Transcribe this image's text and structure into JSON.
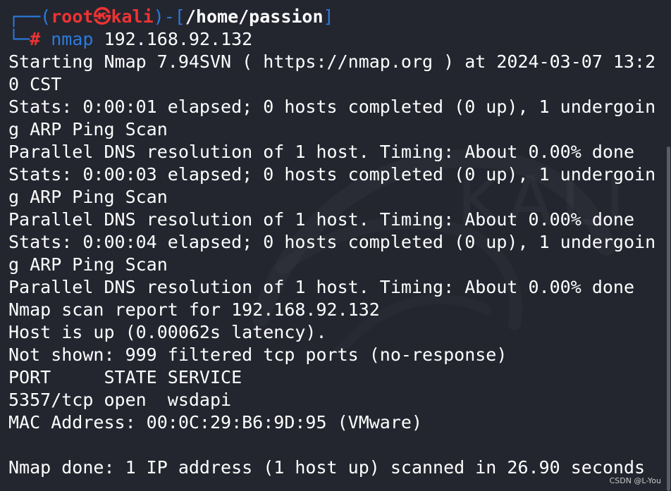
{
  "prompt": {
    "corner_top": "┌──",
    "paren_open": "(",
    "user": "root",
    "at_symbol": "㉿",
    "host": "kali",
    "paren_close": ")",
    "dash": "-",
    "bracket_open": "[",
    "cwd": "/home/passion",
    "bracket_close": "]",
    "corner_bottom": "└─",
    "hash": "#",
    "command": "nmap",
    "argument": "192.168.92.132"
  },
  "output_lines": [
    "Starting Nmap 7.94SVN ( https://nmap.org ) at 2024-03-07 13:2",
    "0 CST",
    "Stats: 0:00:01 elapsed; 0 hosts completed (0 up), 1 undergoin",
    "g ARP Ping Scan",
    "Parallel DNS resolution of 1 host. Timing: About 0.00% done",
    "Stats: 0:00:03 elapsed; 0 hosts completed (0 up), 1 undergoin",
    "g ARP Ping Scan",
    "Parallel DNS resolution of 1 host. Timing: About 0.00% done",
    "Stats: 0:00:04 elapsed; 0 hosts completed (0 up), 1 undergoin",
    "g ARP Ping Scan",
    "Parallel DNS resolution of 1 host. Timing: About 0.00% done",
    "Nmap scan report for 192.168.92.132",
    "Host is up (0.00062s latency).",
    "Not shown: 999 filtered tcp ports (no-response)",
    "PORT     STATE SERVICE",
    "5357/tcp open  wsdapi",
    "MAC Address: 00:0C:29:B6:9D:95 (VMware)",
    "",
    "Nmap done: 1 IP address (1 host up) scanned in 26.90 seconds"
  ],
  "background_watermark": "KALI",
  "credit": "CSDN @L-You",
  "colors": {
    "background": "#23262f",
    "prompt_blue": "#2a7bde",
    "prompt_red": "#ee3333",
    "text": "#ffffff"
  }
}
